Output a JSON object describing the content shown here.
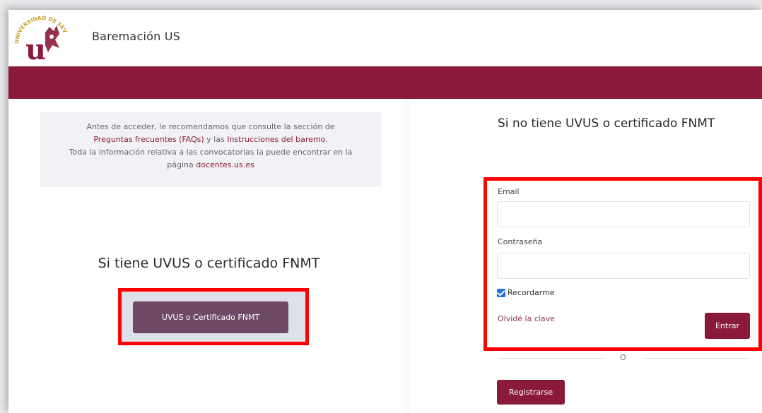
{
  "header": {
    "app_title": "Baremación US",
    "logo_text_top": "UNIVERSIDAD DE SEVILLA",
    "logo_icon": "university-seal-icon"
  },
  "colors": {
    "brand": "#8b1a3a",
    "uvus_button": "#6e4a67",
    "highlight_frame": "#ff0000"
  },
  "info": {
    "line1": "Antes de acceder, le recomendamos que consulte la sección de",
    "faq_link": "Preguntas frecuentes (FAQs)",
    "and": " y las ",
    "instructions_link": "Instrucciones del baremo",
    "period": ".",
    "line3": "Toda la información relativa a las convocatorias la puede encontrar en la",
    "page_prefix": "página ",
    "docentes_link": "docentes.us.es"
  },
  "uvus": {
    "title": "Si tiene UVUS o certificado FNMT",
    "button_label": "UVUS o Certificado FNMT"
  },
  "login": {
    "title": "Si no tiene UVUS o certificado FNMT",
    "email_label": "Email",
    "email_value": "",
    "password_label": "Contraseña",
    "password_value": "",
    "remember_label": "Recordarme",
    "remember_checked": true,
    "forgot_label": "Olvidé la clave",
    "enter_label": "Entrar",
    "separator_text": "O",
    "register_label": "Registrarse"
  }
}
